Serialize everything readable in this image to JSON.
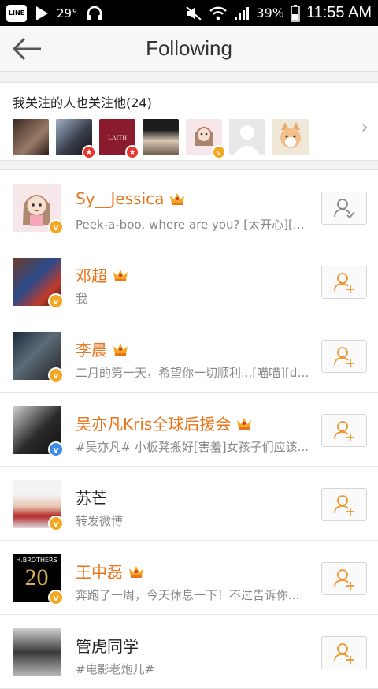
{
  "status_bar": {
    "app_icon_label": "LINE",
    "temperature": "29°",
    "battery": "39%",
    "time": "11:55 AM"
  },
  "header": {
    "title": "Following"
  },
  "recommend": {
    "title": "我关注的人也关注他(24)",
    "avatars": [
      {
        "badge": ""
      },
      {
        "badge": "star"
      },
      {
        "badge": "star",
        "text": "LAITH"
      },
      {
        "badge": ""
      },
      {
        "badge": "v"
      },
      {
        "badge": ""
      },
      {
        "badge": ""
      }
    ]
  },
  "colors": {
    "name_orange": "#e8741b",
    "badge_orange": "#f5a623",
    "badge_blue": "#3a8ee6",
    "badge_red": "#e8352e",
    "followed_icon": "#888888",
    "follow_icon": "#f0962c"
  },
  "users": [
    {
      "name": "Sy__Jessica",
      "desc": "Peek-a-boo, where are you? [太开心][偷笑...",
      "vip": true,
      "verified": "orange",
      "followed": true,
      "name_color": "orange"
    },
    {
      "name": "邓超",
      "desc": "我",
      "vip": true,
      "verified": "orange",
      "followed": false,
      "name_color": "orange"
    },
    {
      "name": "李晨",
      "desc": "二月的第一天，希望你一切顺利...[喵喵][do...",
      "vip": true,
      "verified": "orange",
      "followed": false,
      "name_color": "orange"
    },
    {
      "name": "吴亦凡Kris全球后援会",
      "desc": "#吴亦凡# 小板凳搬好[害羞]女孩子们应该...",
      "vip": true,
      "verified": "blue",
      "followed": false,
      "name_color": "orange"
    },
    {
      "name": "苏芒",
      "desc": "转发微博",
      "vip": false,
      "verified": "orange",
      "followed": false,
      "name_color": "black"
    },
    {
      "name": "王中磊",
      "desc": "奔跑了一周，今天休息一下！不过告诉你...",
      "vip": true,
      "verified": "orange",
      "followed": false,
      "name_color": "orange"
    },
    {
      "name": "管虎同学",
      "desc": "#电影老炮儿#",
      "vip": false,
      "verified": "",
      "followed": false,
      "name_color": "black"
    }
  ]
}
